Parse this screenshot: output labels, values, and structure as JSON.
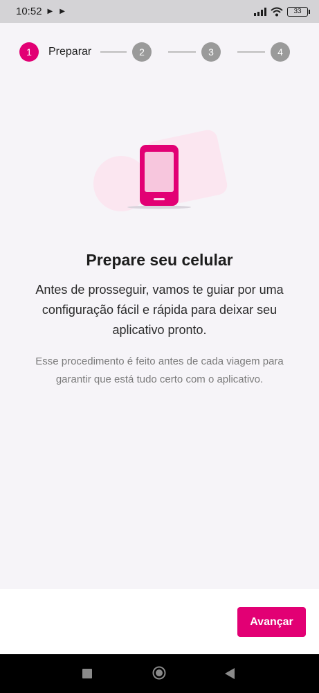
{
  "status_bar": {
    "time": "10:52",
    "battery": "33"
  },
  "stepper": {
    "steps": [
      {
        "number": "1",
        "label": "Preparar"
      },
      {
        "number": "2"
      },
      {
        "number": "3"
      },
      {
        "number": "4"
      }
    ]
  },
  "main": {
    "title": "Prepare seu celular",
    "description": "Antes de prosseguir, vamos te guiar por uma configuração fácil e rápida para deixar seu aplicativo pronto.",
    "note": "Esse procedimento é feito antes de cada viagem para garantir que está tudo certo com o aplicativo."
  },
  "footer": {
    "next_label": "Avançar"
  },
  "colors": {
    "accent": "#e20074",
    "step_inactive": "#9a9a9a"
  },
  "icons": [
    "play-icon",
    "signal-icon",
    "wifi-icon",
    "battery-icon",
    "phone-illustration",
    "recents-icon",
    "home-icon",
    "back-icon"
  ]
}
